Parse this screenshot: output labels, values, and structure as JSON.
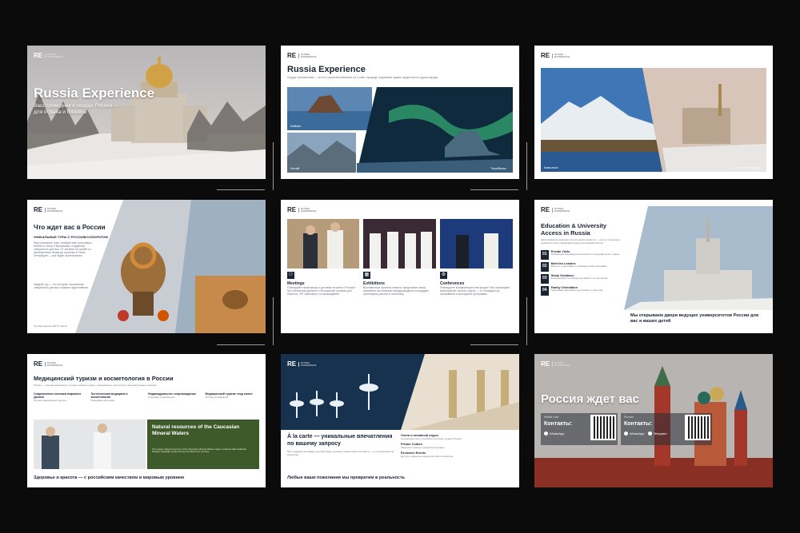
{
  "logo": {
    "mark": "RE",
    "sub": "RUSSIA EXPERIENCE"
  },
  "slide1": {
    "title": "Russia Experience",
    "subtitle": "Ваш проводник в сердце России — для отдыха и бизнеса"
  },
  "slide2": {
    "title": "Russia Experience",
    "tagline": "Сердце путешествия — это не только впечатления, но и опыт, природа, подлинные права, сердечность и душа народа.",
    "labels": [
      "Байкал",
      "Алтай",
      "Териберка"
    ]
  },
  "slide3": {
    "labels": [
      "Камчатка",
      "Санкт-Петербург"
    ]
  },
  "slide4": {
    "title": "Что ждет вас в России",
    "subtitle": "УНИКАЛЬНЫЕ ТУРЫ С РУССКИМ КОЛОРИТОМ",
    "body": "Персональные туры, комфортные трансферы, билеты в театр и программы, созданные специально для вас. От катания на тройке по заснеженным лесам до прогулки в Санкт-Петербурге — всё будет организовано.",
    "body2": "Каждый тур — это история, написанная специально для вас и вашего вдохновения.",
    "footer": "Тур Экспедиции 2024 © Экспо"
  },
  "slide5": {
    "columns": [
      {
        "title": "Meetings",
        "text": "Планируйте переговоры и деловые встречи в России? Мы обеспечим удобные и безопасные условия для бизнеса, VIP-трансфер и сопровождение."
      },
      {
        "title": "Exhibitions",
        "text": "Выставочные проекты помогут представить вашу компанию на ключевых международных площадках, организуем участие и логистику."
      },
      {
        "title": "Conferences",
        "text": "Планируете конференцию или форум? Мы организуем мероприятие полного цикла — от площадки до проживания и культурной программы."
      }
    ]
  },
  "slide6": {
    "title": "Education & University Access in Russia",
    "intro": "Эксклюзивные возможности для наших клиентов — доступ к ведущим университетам и образовательным программам России.",
    "items": [
      {
        "num": "01",
        "title": "Private Visits",
        "text": "Организуем индивидуальные визиты в ведущие вузы страны."
      },
      {
        "num": "02",
        "title": "Meet the Leaders",
        "text": "Встречи с ректорами и руководителями программ."
      },
      {
        "num": "03",
        "title": "Study Guidance",
        "text": "Консультации по выбору программ и поступлению."
      },
      {
        "num": "04",
        "title": "Family Orientation",
        "text": "Программы адаптации для семей и студентов."
      }
    ],
    "footer": "Мы открываем двери ведущих университетов России для вас и ваших детей"
  },
  "slide7": {
    "title": "Медицинский туризм и косметология в России",
    "intro": "Россия — сильная медицина и лучшие клиники страны, современные технологии и высокий уровень сервиса.",
    "features": [
      {
        "title": "Современные клиники мирового уровня",
        "text": "Лучшие медицинские центры"
      },
      {
        "title": "Эстетическая медицина и косметология",
        "text": "Передовые методики"
      },
      {
        "title": "Индивидуальное сопровождение",
        "text": "Трансфер и переводчик"
      },
      {
        "title": "Медицинский туризм «под ключ»",
        "text": "Полная организация"
      }
    ],
    "panel_title": "Natural resources of the Caucasian Mineral Waters",
    "panel_text": "The unique natural resources of the Caucasian Mineral Waters region combined with traditional Russian hospitality create the best conditions for recovery.",
    "footer": "Здоровье и красота — с российским качеством и мировым уровнем"
  },
  "slide8": {
    "title": "À la carte — уникальные впечатления по вашему запросу",
    "intro": "Мы создадим программу, которая будет отражать именно ваши интересы — от гастрономии до искусства.",
    "items": [
      {
        "title": "Охота и активный отдых",
        "text": "Организуем охоту и рыбалку в лучших угодьях России."
      },
      {
        "title": "Private Culture",
        "text": "Закрытые показы и экскурсии в музеях."
      },
      {
        "title": "Exclusive Events",
        "text": "Доступ к закрытым мероприятиям и событиям."
      }
    ],
    "footer": "Любые ваши пожелания мы превратим в реальность"
  },
  "slide9": {
    "title": "Россия ждет вас",
    "contacts": [
      {
        "region": "Middle East",
        "label": "Контакты:",
        "channels": [
          "WhatsApp"
        ]
      },
      {
        "region": "Россия",
        "label": "Контакты:",
        "channels": [
          "WhatsApp",
          "Telegram"
        ]
      }
    ]
  },
  "colors": {
    "background": "#0b0b0c",
    "navy": "#1a2433",
    "accent": "#c9a85a"
  }
}
